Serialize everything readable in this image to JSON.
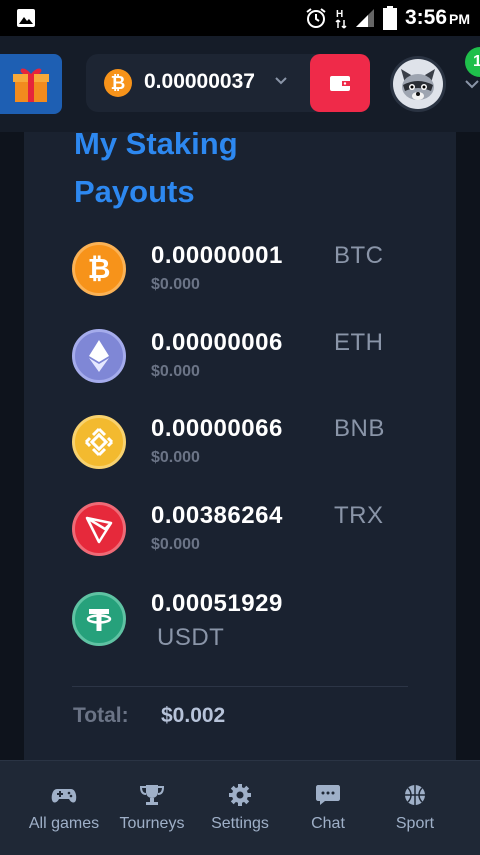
{
  "status_bar": {
    "time": "3:56",
    "ampm": "PM"
  },
  "header": {
    "balance_currency_icon": "bitcoin-icon",
    "balance": "0.00000037",
    "avatar_icon": "raccoon-avatar",
    "notification_count": "1"
  },
  "page": {
    "title_line1": "My Staking",
    "title_line2": "Payouts"
  },
  "payouts": [
    {
      "amount": "0.00000001",
      "symbol": "BTC",
      "usd": "$0.000",
      "icon": "bitcoin-icon",
      "color": "#f7931a"
    },
    {
      "amount": "0.00000006",
      "symbol": "ETH",
      "usd": "$0.000",
      "icon": "ethereum-icon",
      "color": "#8a94e6"
    },
    {
      "amount": "0.00000066",
      "symbol": "BNB",
      "usd": "$0.000",
      "icon": "bnb-icon",
      "color": "#f3ba2f"
    },
    {
      "amount": "0.00386264",
      "symbol": "TRX",
      "usd": "$0.000",
      "icon": "tron-icon",
      "color": "#e6293b"
    },
    {
      "amount": "0.00051929",
      "symbol": "USDT",
      "usd": "",
      "icon": "tether-icon",
      "color": "#26a17b"
    }
  ],
  "total": {
    "label": "Total:",
    "value": "$0.002"
  },
  "bottom_nav": [
    {
      "label": "All games",
      "icon": "gamepad-icon"
    },
    {
      "label": "Tourneys",
      "icon": "trophy-icon"
    },
    {
      "label": "Settings",
      "icon": "gear-icon"
    },
    {
      "label": "Chat",
      "icon": "chat-icon"
    },
    {
      "label": "Sport",
      "icon": "basketball-icon"
    }
  ],
  "colors": {
    "accent": "#2d88f0",
    "wallet": "#ef2a49",
    "badge": "#1fbf4b",
    "background": "#121823"
  }
}
